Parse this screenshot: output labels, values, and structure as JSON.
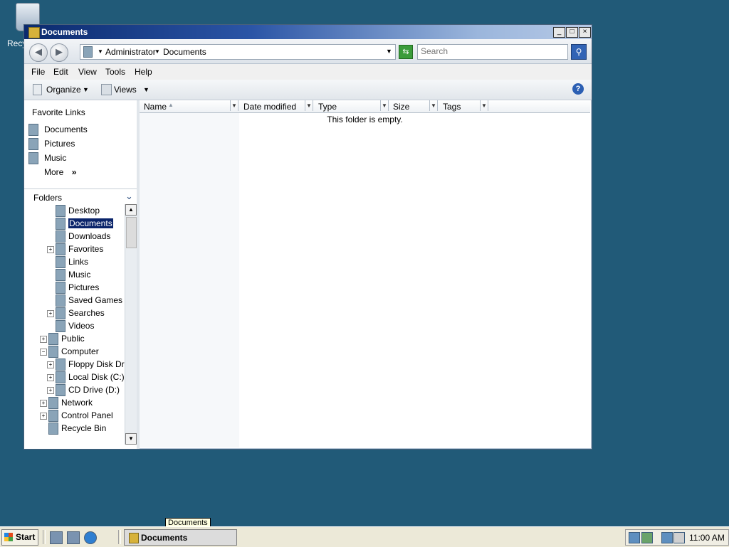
{
  "desktop": {
    "recycle_label": "Recy"
  },
  "window": {
    "title": "Documents",
    "controls": {
      "minimize": "_",
      "maximize": "□",
      "close": "×"
    }
  },
  "address": {
    "crumbs": [
      "Administrator",
      "Documents"
    ],
    "search_placeholder": "Search"
  },
  "menu": [
    "File",
    "Edit",
    "View",
    "Tools",
    "Help"
  ],
  "toolbar": {
    "organize": "Organize",
    "views": "Views"
  },
  "favorites": {
    "title": "Favorite Links",
    "items": [
      "Documents",
      "Pictures",
      "Music"
    ],
    "more": "More",
    "more_glyph": "»"
  },
  "folders": {
    "title": "Folders",
    "tree": [
      {
        "label": "Desktop"
      },
      {
        "label": "Documents",
        "selected": true
      },
      {
        "label": "Downloads"
      },
      {
        "label": "Favorites",
        "expandable": true
      },
      {
        "label": "Links"
      },
      {
        "label": "Music"
      },
      {
        "label": "Pictures"
      },
      {
        "label": "Saved Games"
      },
      {
        "label": "Searches",
        "expandable": true
      },
      {
        "label": "Videos"
      },
      {
        "label": "Public",
        "expandable": true
      },
      {
        "label": "Computer",
        "expanded": true
      },
      {
        "label": "Floppy Disk Drive",
        "expandable": true
      },
      {
        "label": "Local Disk (C:)",
        "expandable": true
      },
      {
        "label": "CD Drive (D:)",
        "expandable": true
      },
      {
        "label": "Network",
        "expandable": true
      },
      {
        "label": "Control Panel",
        "expandable": true
      },
      {
        "label": "Recycle Bin"
      }
    ]
  },
  "columns": [
    "Name",
    "Date modified",
    "Type",
    "Size",
    "Tags"
  ],
  "content": {
    "empty_message": "This folder is empty."
  },
  "taskbar": {
    "start": "Start",
    "task_label": "Documents",
    "tooltip": "Documents",
    "clock": "11:00 AM"
  },
  "colors": {
    "desktop": "#215a78",
    "selection": "#0a246a",
    "title_start": "#0b2a6e"
  }
}
